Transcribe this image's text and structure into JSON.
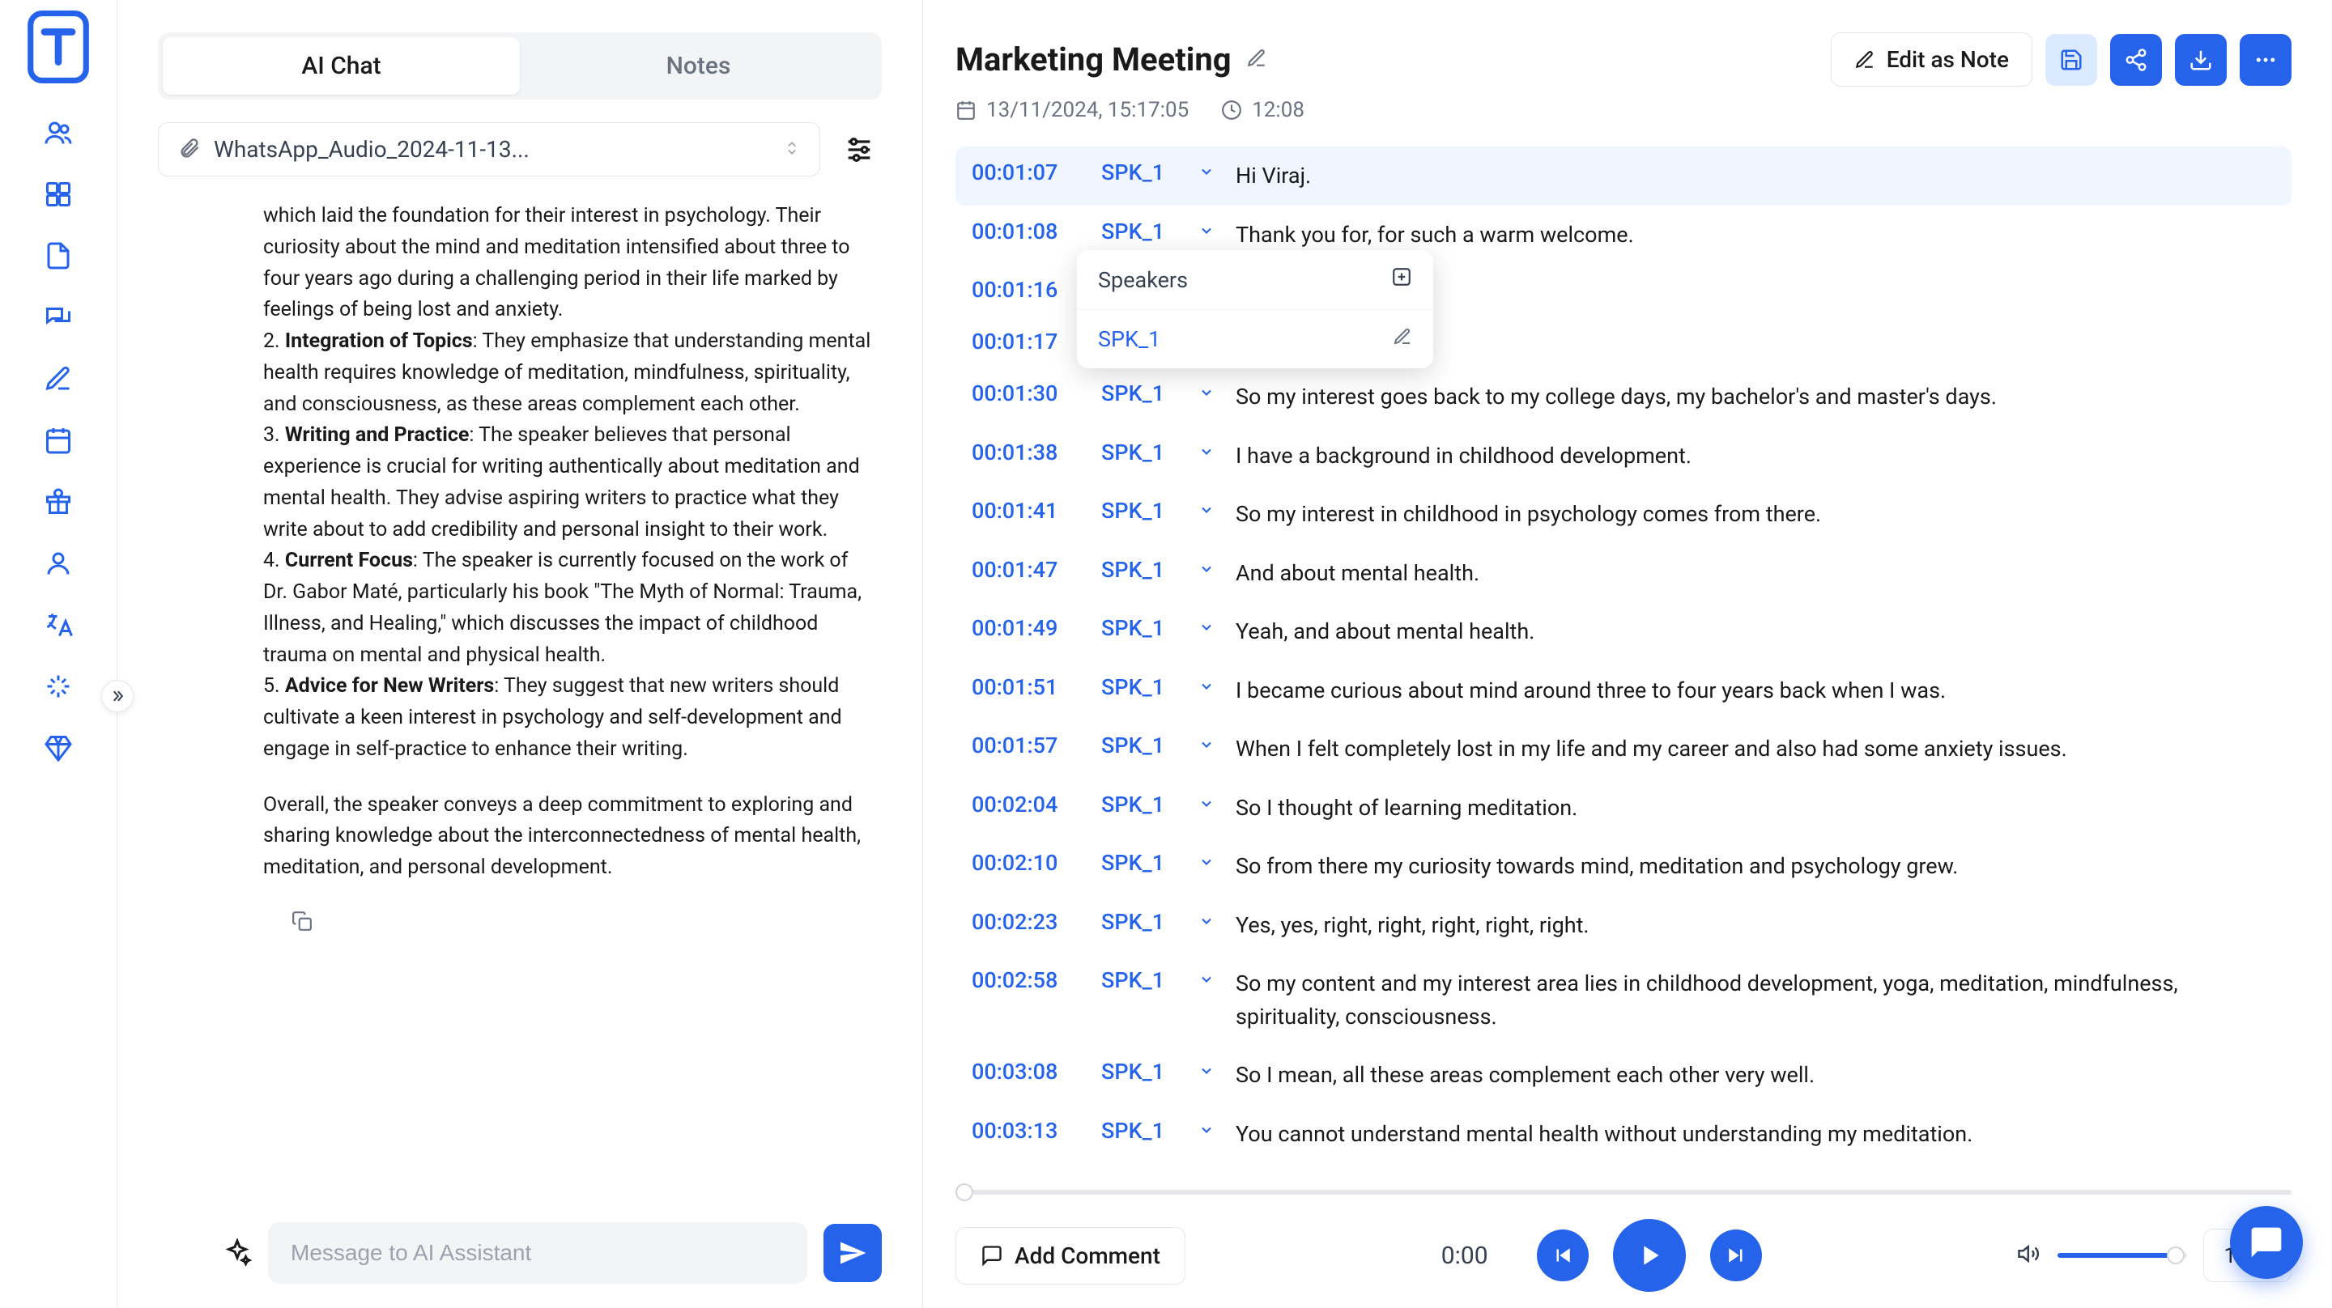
{
  "tabs": {
    "ai_chat": "AI Chat",
    "notes": "Notes"
  },
  "file": {
    "name": "WhatsApp_Audio_2024-11-13..."
  },
  "chat": {
    "items": [
      {
        "prefix": "which laid the foundation for their interest in psychology. Their curiosity about the mind and meditation intensified about three to four years ago during a challenging period in their life marked by feelings of being lost and anxiety."
      },
      {
        "num": "2. ",
        "title": "Integration of Topics",
        "text": ": They emphasize that understanding mental health requires knowledge of meditation, mindfulness, spirituality, and consciousness, as these areas complement each other."
      },
      {
        "num": "3. ",
        "title": "Writing and Practice",
        "text": ": The speaker believes that personal experience is crucial for writing authentically about meditation and mental health. They advise aspiring writers to practice what they write about to add credibility and personal insight to their work."
      },
      {
        "num": "4. ",
        "title": "Current Focus",
        "text": ": The speaker is currently focused on the work of Dr. Gabor Maté, particularly his book \"The Myth of Normal: Trauma, Illness, and Healing,\" which discusses the impact of childhood trauma on mental and physical health."
      },
      {
        "num": "5. ",
        "title": "Advice for New Writers",
        "text": ": They suggest that new writers should cultivate a keen interest in psychology and self-development and engage in self-practice to enhance their writing."
      }
    ],
    "overall": "Overall, the speaker conveys a deep commitment to exploring and sharing knowledge about the interconnectedness of mental health, meditation, and personal development.",
    "input_placeholder": "Message to AI Assistant"
  },
  "header": {
    "title": "Marketing Meeting",
    "edit_note": "Edit as Note",
    "date": "13/11/2024, 15:17:05",
    "duration": "12:08"
  },
  "speakers_popup": {
    "title": "Speakers",
    "speaker": "SPK_1"
  },
  "transcript": [
    {
      "t": "00:01:07",
      "s": "SPK_1",
      "text": "Hi Viraj.",
      "hl": true
    },
    {
      "t": "00:01:08",
      "s": "SPK_1",
      "text": "Thank you for, for such a warm welcome."
    },
    {
      "t": "00:01:16",
      "s": "",
      "text": ""
    },
    {
      "t": "00:01:17",
      "s": "",
      "text": ""
    },
    {
      "t": "00:01:30",
      "s": "SPK_1",
      "text": "So my interest goes back to my college days, my bachelor's and master's days."
    },
    {
      "t": "00:01:38",
      "s": "SPK_1",
      "text": "I have a background in childhood development."
    },
    {
      "t": "00:01:41",
      "s": "SPK_1",
      "text": "So my interest in childhood in psychology comes from there."
    },
    {
      "t": "00:01:47",
      "s": "SPK_1",
      "text": "And about mental health."
    },
    {
      "t": "00:01:49",
      "s": "SPK_1",
      "text": "Yeah, and about mental health."
    },
    {
      "t": "00:01:51",
      "s": "SPK_1",
      "text": "I became curious about mind around three to four years back when I was."
    },
    {
      "t": "00:01:57",
      "s": "SPK_1",
      "text": "When I felt completely lost in my life and my career and also had some anxiety issues."
    },
    {
      "t": "00:02:04",
      "s": "SPK_1",
      "text": "So I thought of learning meditation."
    },
    {
      "t": "00:02:10",
      "s": "SPK_1",
      "text": "So from there my curiosity towards mind, meditation and psychology grew."
    },
    {
      "t": "00:02:23",
      "s": "SPK_1",
      "text": "Yes, yes, right, right, right, right, right."
    },
    {
      "t": "00:02:58",
      "s": "SPK_1",
      "text": "So my content and my interest area lies in childhood development, yoga, meditation, mindfulness, spirituality, consciousness."
    },
    {
      "t": "00:03:08",
      "s": "SPK_1",
      "text": "So I mean, all these areas complement each other very well."
    },
    {
      "t": "00:03:13",
      "s": "SPK_1",
      "text": "You cannot understand mental health without understanding my meditation."
    }
  ],
  "player": {
    "add_comment": "Add Comment",
    "time": "0:00",
    "speed": "1x"
  }
}
